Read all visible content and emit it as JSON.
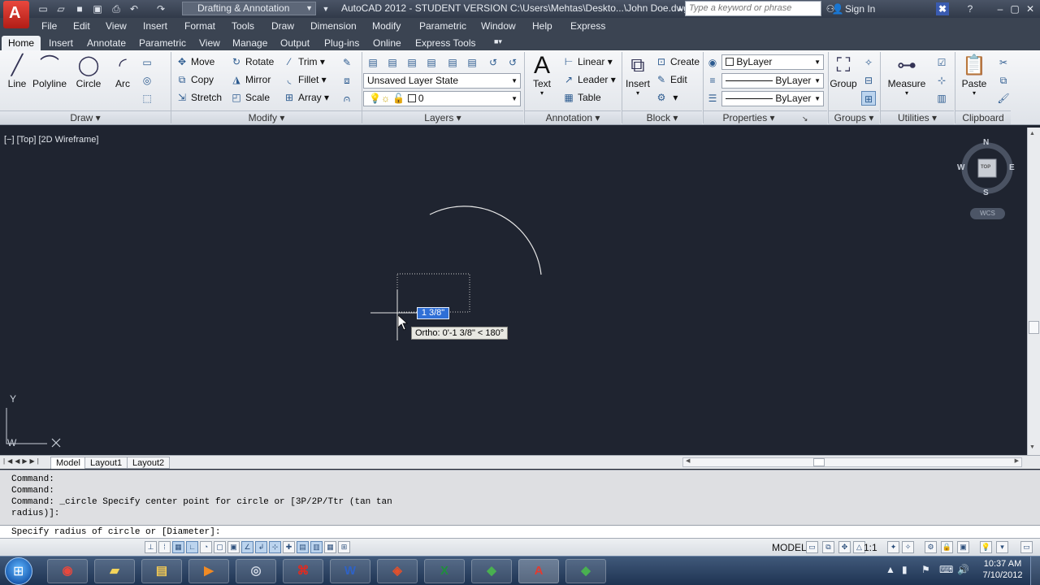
{
  "app": {
    "logo_letter": "A",
    "workspace": "Drafting & Annotation",
    "window_title": "AutoCAD 2012 - STUDENT VERSION    C:\\Users\\Mehtas\\Deskto...\\John Doe.dwg",
    "search_placeholder": "Type a keyword or phrase",
    "sign_in": "Sign In"
  },
  "menu": [
    "File",
    "Edit",
    "View",
    "Insert",
    "Format",
    "Tools",
    "Draw",
    "Dimension",
    "Modify",
    "Parametric",
    "Window",
    "Help",
    "Express"
  ],
  "tabs": [
    "Home",
    "Insert",
    "Annotate",
    "Parametric",
    "View",
    "Manage",
    "Output",
    "Plug-ins",
    "Online",
    "Express Tools"
  ],
  "ribbon": {
    "draw": {
      "label": "Draw",
      "line": "Line",
      "polyline": "Polyline",
      "circle": "Circle",
      "arc": "Arc"
    },
    "modify": {
      "label": "Modify",
      "move": "Move",
      "rotate": "Rotate",
      "trim": "Trim",
      "copy": "Copy",
      "mirror": "Mirror",
      "fillet": "Fillet",
      "stretch": "Stretch",
      "scale": "Scale",
      "array": "Array"
    },
    "layers": {
      "label": "Layers",
      "layer_state": "Unsaved Layer State",
      "current_layer": "0"
    },
    "annotation": {
      "label": "Annotation",
      "text": "Text",
      "linear": "Linear",
      "leader": "Leader",
      "table": "Table"
    },
    "block": {
      "label": "Block",
      "insert": "Insert",
      "create": "Create",
      "edit": "Edit"
    },
    "properties": {
      "label": "Properties",
      "color": "ByLayer",
      "linetype": "ByLayer",
      "lineweight": "ByLayer"
    },
    "groups": {
      "label": "Groups",
      "group": "Group"
    },
    "utilities": {
      "label": "Utilities",
      "measure": "Measure"
    },
    "clipboard": {
      "label": "Clipboard",
      "paste": "Paste"
    }
  },
  "viewport": {
    "label": "[−] [Top] [2D Wireframe]",
    "viewcube": {
      "n": "N",
      "s": "S",
      "e": "E",
      "w": "W",
      "face": "TOP",
      "wcs": "WCS"
    },
    "ucs": {
      "y": "Y",
      "w": "W"
    },
    "dynamic_input": "1 3/8\"",
    "tooltip": "Ortho: 0'-1 3/8\" < 180°"
  },
  "layout_tabs": [
    "Model",
    "Layout1",
    "Layout2"
  ],
  "command": {
    "history": [
      "Command:",
      "Command:",
      "Command: _circle Specify center point for circle or [3P/2P/Ttr (tan tan",
      "radius)]:"
    ],
    "prompt": "Specify radius of circle or [Diameter]:"
  },
  "status": {
    "model": "MODEL",
    "scale": "1:1"
  },
  "clock": {
    "time": "10:37 AM",
    "date": "7/10/2012"
  },
  "taskbar_apps": [
    "chrome",
    "explorer-folder",
    "files",
    "media-player",
    "camera",
    "acrobat",
    "word",
    "office",
    "excel",
    "sketchup",
    "autocad",
    "autocad-2"
  ]
}
